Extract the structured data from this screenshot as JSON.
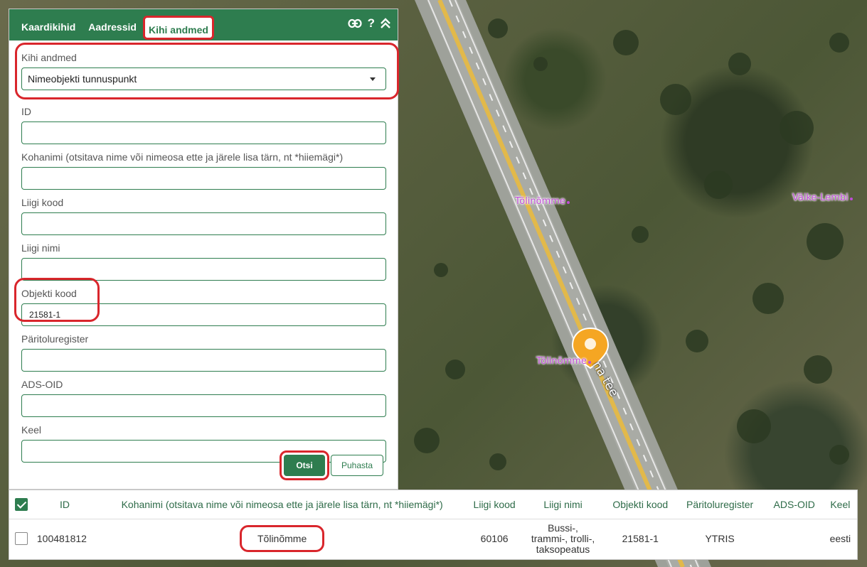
{
  "tabs": [
    {
      "label": "Kaardikihid"
    },
    {
      "label": "Aadressid"
    },
    {
      "label": "Kihi andmed"
    }
  ],
  "header_icons": [
    "link-icon",
    "help-icon",
    "collapse-icon"
  ],
  "help_glyph": "?",
  "layer": {
    "label": "Kihi andmed",
    "selected": "Nimeobjekti tunnuspunkt"
  },
  "fields": {
    "id": {
      "label": "ID",
      "value": ""
    },
    "kohanimi": {
      "label": "Kohanimi (otsitava nime või nimeosa ette ja järele lisa tärn, nt *hiiemägi*)",
      "value": ""
    },
    "liigi_kood": {
      "label": "Liigi kood",
      "value": ""
    },
    "liigi_nimi": {
      "label": "Liigi nimi",
      "value": ""
    },
    "objekti_kood": {
      "label": "Objekti kood",
      "value": "21581-1"
    },
    "paritoluregister": {
      "label": "Päritoluregister",
      "value": ""
    },
    "ads_oid": {
      "label": "ADS-OID",
      "value": ""
    },
    "keel": {
      "label": "Keel",
      "value": ""
    }
  },
  "buttons": {
    "search": "Otsi",
    "clear": "Puhasta"
  },
  "results": {
    "columns": [
      "ID",
      "Kohanimi (otsitava nime või nimeosa ette ja järele lisa tärn, nt *hiiemägi*)",
      "Liigi kood",
      "Liigi nimi",
      "Objekti kood",
      "Päritoluregister",
      "ADS-OID",
      "Keel"
    ],
    "rows": [
      {
        "id": "100481812",
        "kohanimi": "Tõlinõmme",
        "liigi_kood": "60106",
        "liigi_nimi": [
          "Bussi-,",
          "trammi-, trolli-,",
          "taksopeatus"
        ],
        "objekti_kood": "21581-1",
        "paritoluregister": "YTRIS",
        "ads_oid": "",
        "keel": "eesti"
      }
    ]
  },
  "map": {
    "labels": {
      "tolinomme_1": "Tõlinõmme",
      "tolinomme_2": "Tõlinõmme",
      "vaike_lembi": "Väike-Lembi",
      "road": "na tee"
    },
    "marker_color": "#f5a623",
    "label_color": "#c04cd8"
  },
  "colors": {
    "accent": "#2e7d4f",
    "highlight": "#d9262c"
  }
}
